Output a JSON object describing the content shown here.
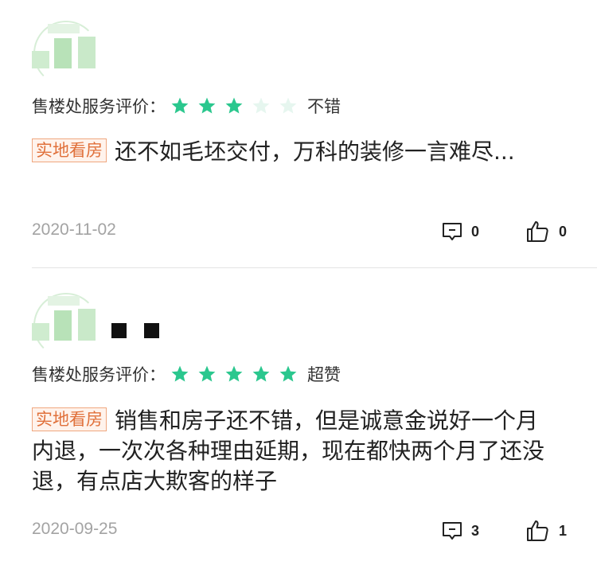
{
  "reviews": [
    {
      "rating_label": "售楼处服务评价：",
      "rating": 3,
      "rating_max": 5,
      "rating_text": "不错",
      "tag": "实地看房",
      "content": "还不如毛坯交付，万科的装修一言难尽...",
      "date": "2020-11-02",
      "comment_count": "0",
      "like_count": "0"
    },
    {
      "rating_label": "售楼处服务评价：",
      "rating": 5,
      "rating_max": 5,
      "rating_text": "超赞",
      "tag": "实地看房",
      "content": "销售和房子还不错，但是诚意金说好一个月内退，一次次各种理由延期，现在都快两个月了还没退，有点店大欺客的样子",
      "date": "2020-09-25",
      "comment_count": "3",
      "like_count": "1"
    }
  ],
  "colors": {
    "star_filled": "#2bc78e",
    "star_empty": "#e6f6ef",
    "tag_text": "#e0703a",
    "date": "#a3a3a3"
  },
  "icons": {
    "comment": "comment-icon",
    "like": "thumbs-up-icon",
    "star": "star-icon"
  }
}
